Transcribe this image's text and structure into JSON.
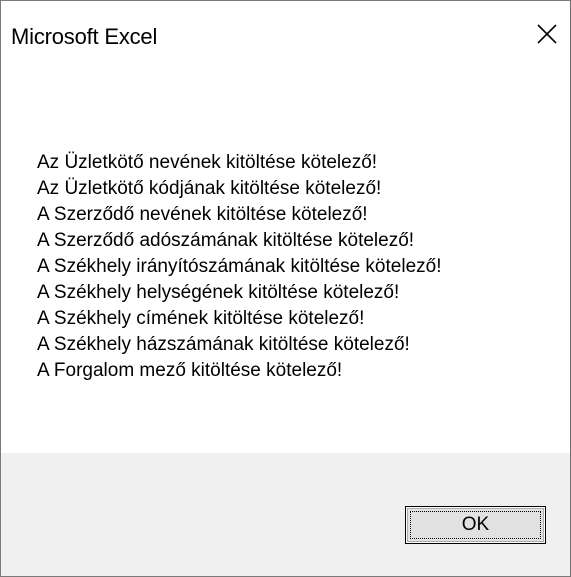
{
  "window": {
    "title": "Microsoft Excel",
    "close_icon": "close-icon"
  },
  "message_lines": [
    "Az Üzletkötő nevének kitöltése kötelező!",
    "Az Üzletkötő kódjának kitöltése kötelező!",
    "A Szerződő nevének kitöltése kötelező!",
    "A Szerződő adószámának kitöltése kötelező!",
    "A Székhely irányítószámának kitöltése kötelező!",
    "A Székhely helységének kitöltése kötelező!",
    "A Székhely címének kitöltése kötelező!",
    "A Székhely házszámának kitöltése kötelező!",
    "A Forgalom mező kitöltése kötelező!"
  ],
  "buttons": {
    "ok_label": "OK"
  },
  "colors": {
    "background": "#ffffff",
    "footer": "#f0f0f0",
    "button_face": "#e1e1e1",
    "text": "#000000"
  }
}
